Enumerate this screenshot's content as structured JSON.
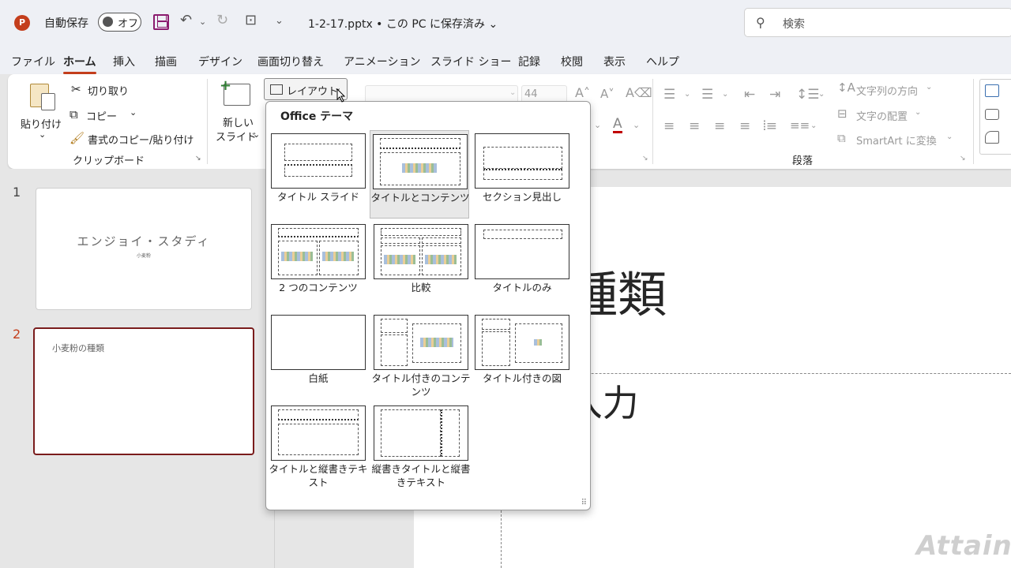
{
  "titlebar": {
    "app_logo": "P",
    "autosave_label": "自動保存",
    "autosave_toggle": "オフ",
    "filename": "1-2-17.pptx • この PC に保存済み ⌄",
    "search_placeholder": "検索"
  },
  "tabs": [
    "ファイル",
    "ホーム",
    "挿入",
    "描画",
    "デザイン",
    "画面切り替え",
    "アニメーション",
    "スライド ショー",
    "記録",
    "校閲",
    "表示",
    "ヘルプ"
  ],
  "ribbon": {
    "clipboard": {
      "paste_label": "貼り付け",
      "cut_label": "切り取り",
      "copy_label": "コピー",
      "format_painter_label": "書式のコピー/貼り付け",
      "group_label": "クリップボード"
    },
    "slides": {
      "new_slide_line1": "新しい",
      "new_slide_line2": "スライド",
      "layout_label": "レイアウト"
    },
    "font": {
      "font_size": "44"
    },
    "paragraph": {
      "text_direction_label": "文字列の方向",
      "align_text_label": "文字の配置",
      "smartart_label": "SmartArt に変換",
      "group_label": "段落"
    }
  },
  "slides_pane": {
    "items": [
      {
        "number": "1",
        "title": "エンジョイ・スタディ",
        "subtitle": "小麦粉"
      },
      {
        "number": "2",
        "title": "小麦粉の種類"
      }
    ]
  },
  "main_slide": {
    "title": "麦粉の種類",
    "body": "キストを入力"
  },
  "layout_gallery": {
    "header": "Office テーマ",
    "layouts": [
      {
        "name": "タイトル スライド"
      },
      {
        "name": "タイトルとコンテンツ"
      },
      {
        "name": "セクション見出し"
      },
      {
        "name": "2 つのコンテンツ"
      },
      {
        "name": "比較"
      },
      {
        "name": "タイトルのみ"
      },
      {
        "name": "白紙"
      },
      {
        "name": "タイトル付きのコンテンツ"
      },
      {
        "name": "タイトル付きの図"
      },
      {
        "name": "タイトルと縦書きテキスト"
      },
      {
        "name": "縦書きタイトルと縦書きテキスト"
      }
    ]
  },
  "watermark": "Attain",
  "colors": {
    "accent": "#c43e1c",
    "active_slide_border": "#7a1c1c"
  }
}
